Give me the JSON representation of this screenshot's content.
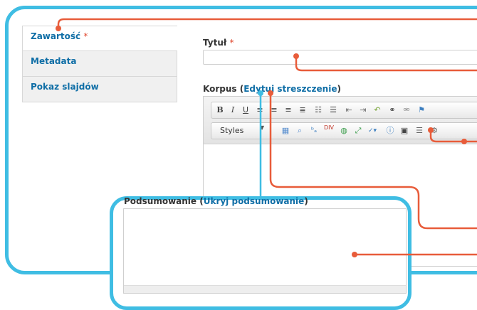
{
  "tabs": [
    {
      "label": "Zawartość",
      "required": "*"
    },
    {
      "label": "Metadata"
    },
    {
      "label": "Pokaz slajdów"
    }
  ],
  "title_field": {
    "label": "Tytuł",
    "required": "*",
    "value": ""
  },
  "body_field": {
    "label": "Korpus",
    "open_paren": "(",
    "link": "Edytuj streszczenie",
    "close_paren": ")"
  },
  "toolbar": {
    "row1": [
      "bold",
      "italic",
      "underline",
      "align-left",
      "align-center",
      "align-right",
      "justify",
      "bulleted-list",
      "numbered-list",
      "outdent",
      "indent",
      "undo",
      "link",
      "unlink",
      "flag"
    ],
    "styles_label": "Styles",
    "row2": [
      "table",
      "find",
      "replace",
      "spell-abc",
      "div",
      "globe",
      "maximize",
      "spellcheck",
      "info",
      "image",
      "horizontal-rule",
      "source"
    ]
  },
  "summary_field": {
    "label": "Podsumowanie",
    "open_paren": "(",
    "link": "Ukryj podsumowanie",
    "close_paren": ")",
    "value": ""
  },
  "colors": {
    "accent_blue": "#3fbde3",
    "callout_orange": "#e85c3a",
    "link_blue": "#0f6ea6",
    "required_red": "#e0442b"
  }
}
